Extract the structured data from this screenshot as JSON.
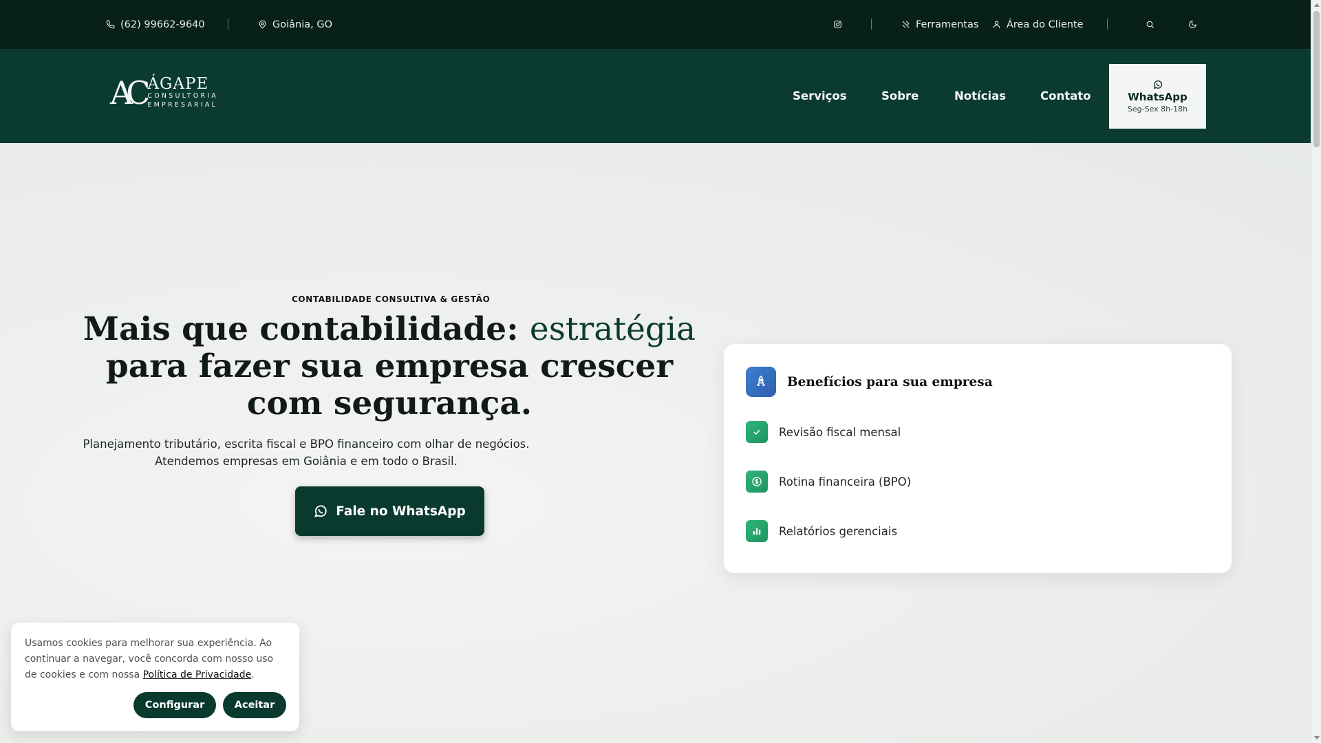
{
  "topbar": {
    "phone": "(62) 99662-9640",
    "location": "Goiânia, GO",
    "tools": "Ferramentas",
    "client_area": "Área do Cliente",
    "icons": [
      "phone-icon",
      "map-pin-icon",
      "instagram-icon",
      "tools-icon",
      "user-icon",
      "search-icon",
      "moon-icon"
    ]
  },
  "header": {
    "logo": {
      "mono": "AC",
      "brand": "ÁGAPE",
      "line1": "CONSULTORIA",
      "line2": "EMPRESARIAL"
    },
    "nav": [
      "Serviços",
      "Sobre",
      "Notícias",
      "Contato"
    ],
    "whatsapp": {
      "label": "WhatsApp",
      "hours": "Seg-Sex 8h-18h"
    }
  },
  "hero": {
    "eyebrow": "CONTABILIDADE CONSULTIVA & GESTÃO",
    "headline_before": "Mais que contabilidade: ",
    "headline_accent": "estratégia",
    "headline_after": " para fazer sua empresa crescer com segurança.",
    "lede_line1": "Planejamento tributário, escrita fiscal e BPO financeiro com olhar de negócios.",
    "lede_line2": "Atendemos empresas em Goiânia e em todo o Brasil.",
    "cta": "Fale no WhatsApp"
  },
  "benefits": {
    "title": "Benefícios para sua empresa",
    "items": [
      {
        "label": "Revisão fiscal mensal",
        "icon": "check-icon"
      },
      {
        "label": "Rotina financeira (BPO)",
        "icon": "dollar-icon"
      },
      {
        "label": "Relatórios gerenciais",
        "icon": "bar-chart-icon"
      }
    ]
  },
  "cookie": {
    "text": "Usamos cookies para melhorar sua experiência. Ao continuar a navegar, você concorda com nosso uso de cookies e com nossa ",
    "link": "Política de Privacidade",
    "end": ".",
    "configure": "Configurar",
    "accept": "Aceitar"
  },
  "colors": {
    "dark": "#07201a",
    "brand": "#0b3b30",
    "accent_green": "#30b47a",
    "accent_blue": "#3f7fd0"
  }
}
